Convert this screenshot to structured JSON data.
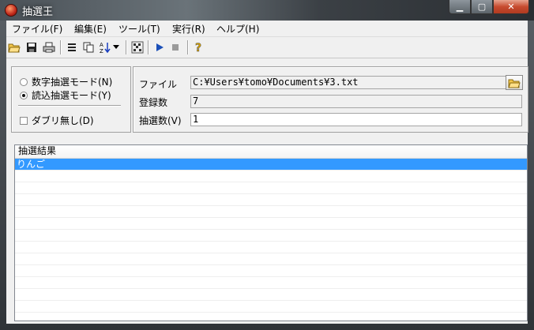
{
  "window": {
    "title": "抽選王"
  },
  "menu": [
    "ファイル(F)",
    "編集(E)",
    "ツール(T)",
    "実行(R)",
    "ヘルプ(H)"
  ],
  "toolbar": [
    "open-icon",
    "save-icon",
    "print-icon",
    "list-icon",
    "copy-icon",
    "sort-icon",
    "dropdown-arrow-icon",
    "shuffle-icon",
    "play-icon",
    "stop-icon",
    "help-icon"
  ],
  "mode": {
    "numeric_label": "数字抽選モード(N)",
    "read_label": "読込抽選モード(Y)",
    "selected": "read",
    "no_duplicates_label": "ダブリ無し(D)",
    "no_duplicates_checked": false
  },
  "settings": {
    "file_label": "ファイル",
    "file_value": "C:¥Users¥tomo¥Documents¥3.txt",
    "count_label": "登録数",
    "count_value": "7",
    "draw_label": "抽選数(V)",
    "draw_value": "1"
  },
  "results": {
    "header": "抽選結果",
    "rows": [
      "りんご"
    ]
  }
}
